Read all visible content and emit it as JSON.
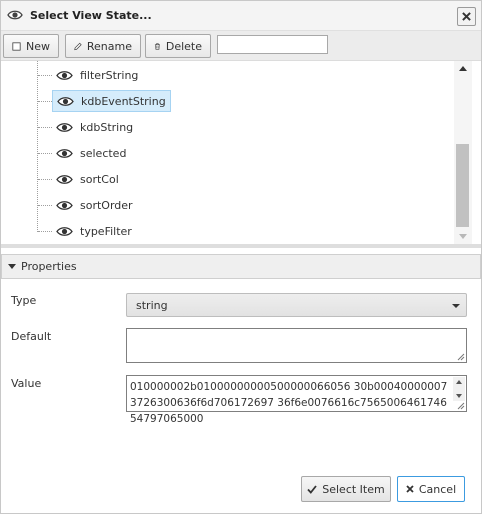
{
  "dialog": {
    "title": "Select View State...",
    "icons": {
      "title": "eye-icon",
      "close": "close-icon"
    }
  },
  "toolbar": {
    "new_label": "New",
    "rename_label": "Rename",
    "delete_label": "Delete",
    "search_value": ""
  },
  "tree": {
    "items": [
      {
        "label": "filterString",
        "selected": false
      },
      {
        "label": "kdbEventString",
        "selected": true
      },
      {
        "label": "kdbString",
        "selected": false
      },
      {
        "label": "selected",
        "selected": false
      },
      {
        "label": "sortCol",
        "selected": false
      },
      {
        "label": "sortOrder",
        "selected": false
      },
      {
        "label": "typeFilter",
        "selected": false
      }
    ]
  },
  "properties": {
    "title": "Properties",
    "type_label": "Type",
    "type_value": "string",
    "default_label": "Default",
    "default_value": "",
    "value_label": "Value",
    "value_text": "010000002b01000000000500000066056 30b000400000073726300636f6d706172697 36f6e0076616c756500646174654797065000"
  },
  "footer": {
    "select_label": "Select Item",
    "cancel_label": "Cancel"
  },
  "colors": {
    "selected_bg": "#d5ecfb",
    "cancel_border": "#3c9be0"
  }
}
